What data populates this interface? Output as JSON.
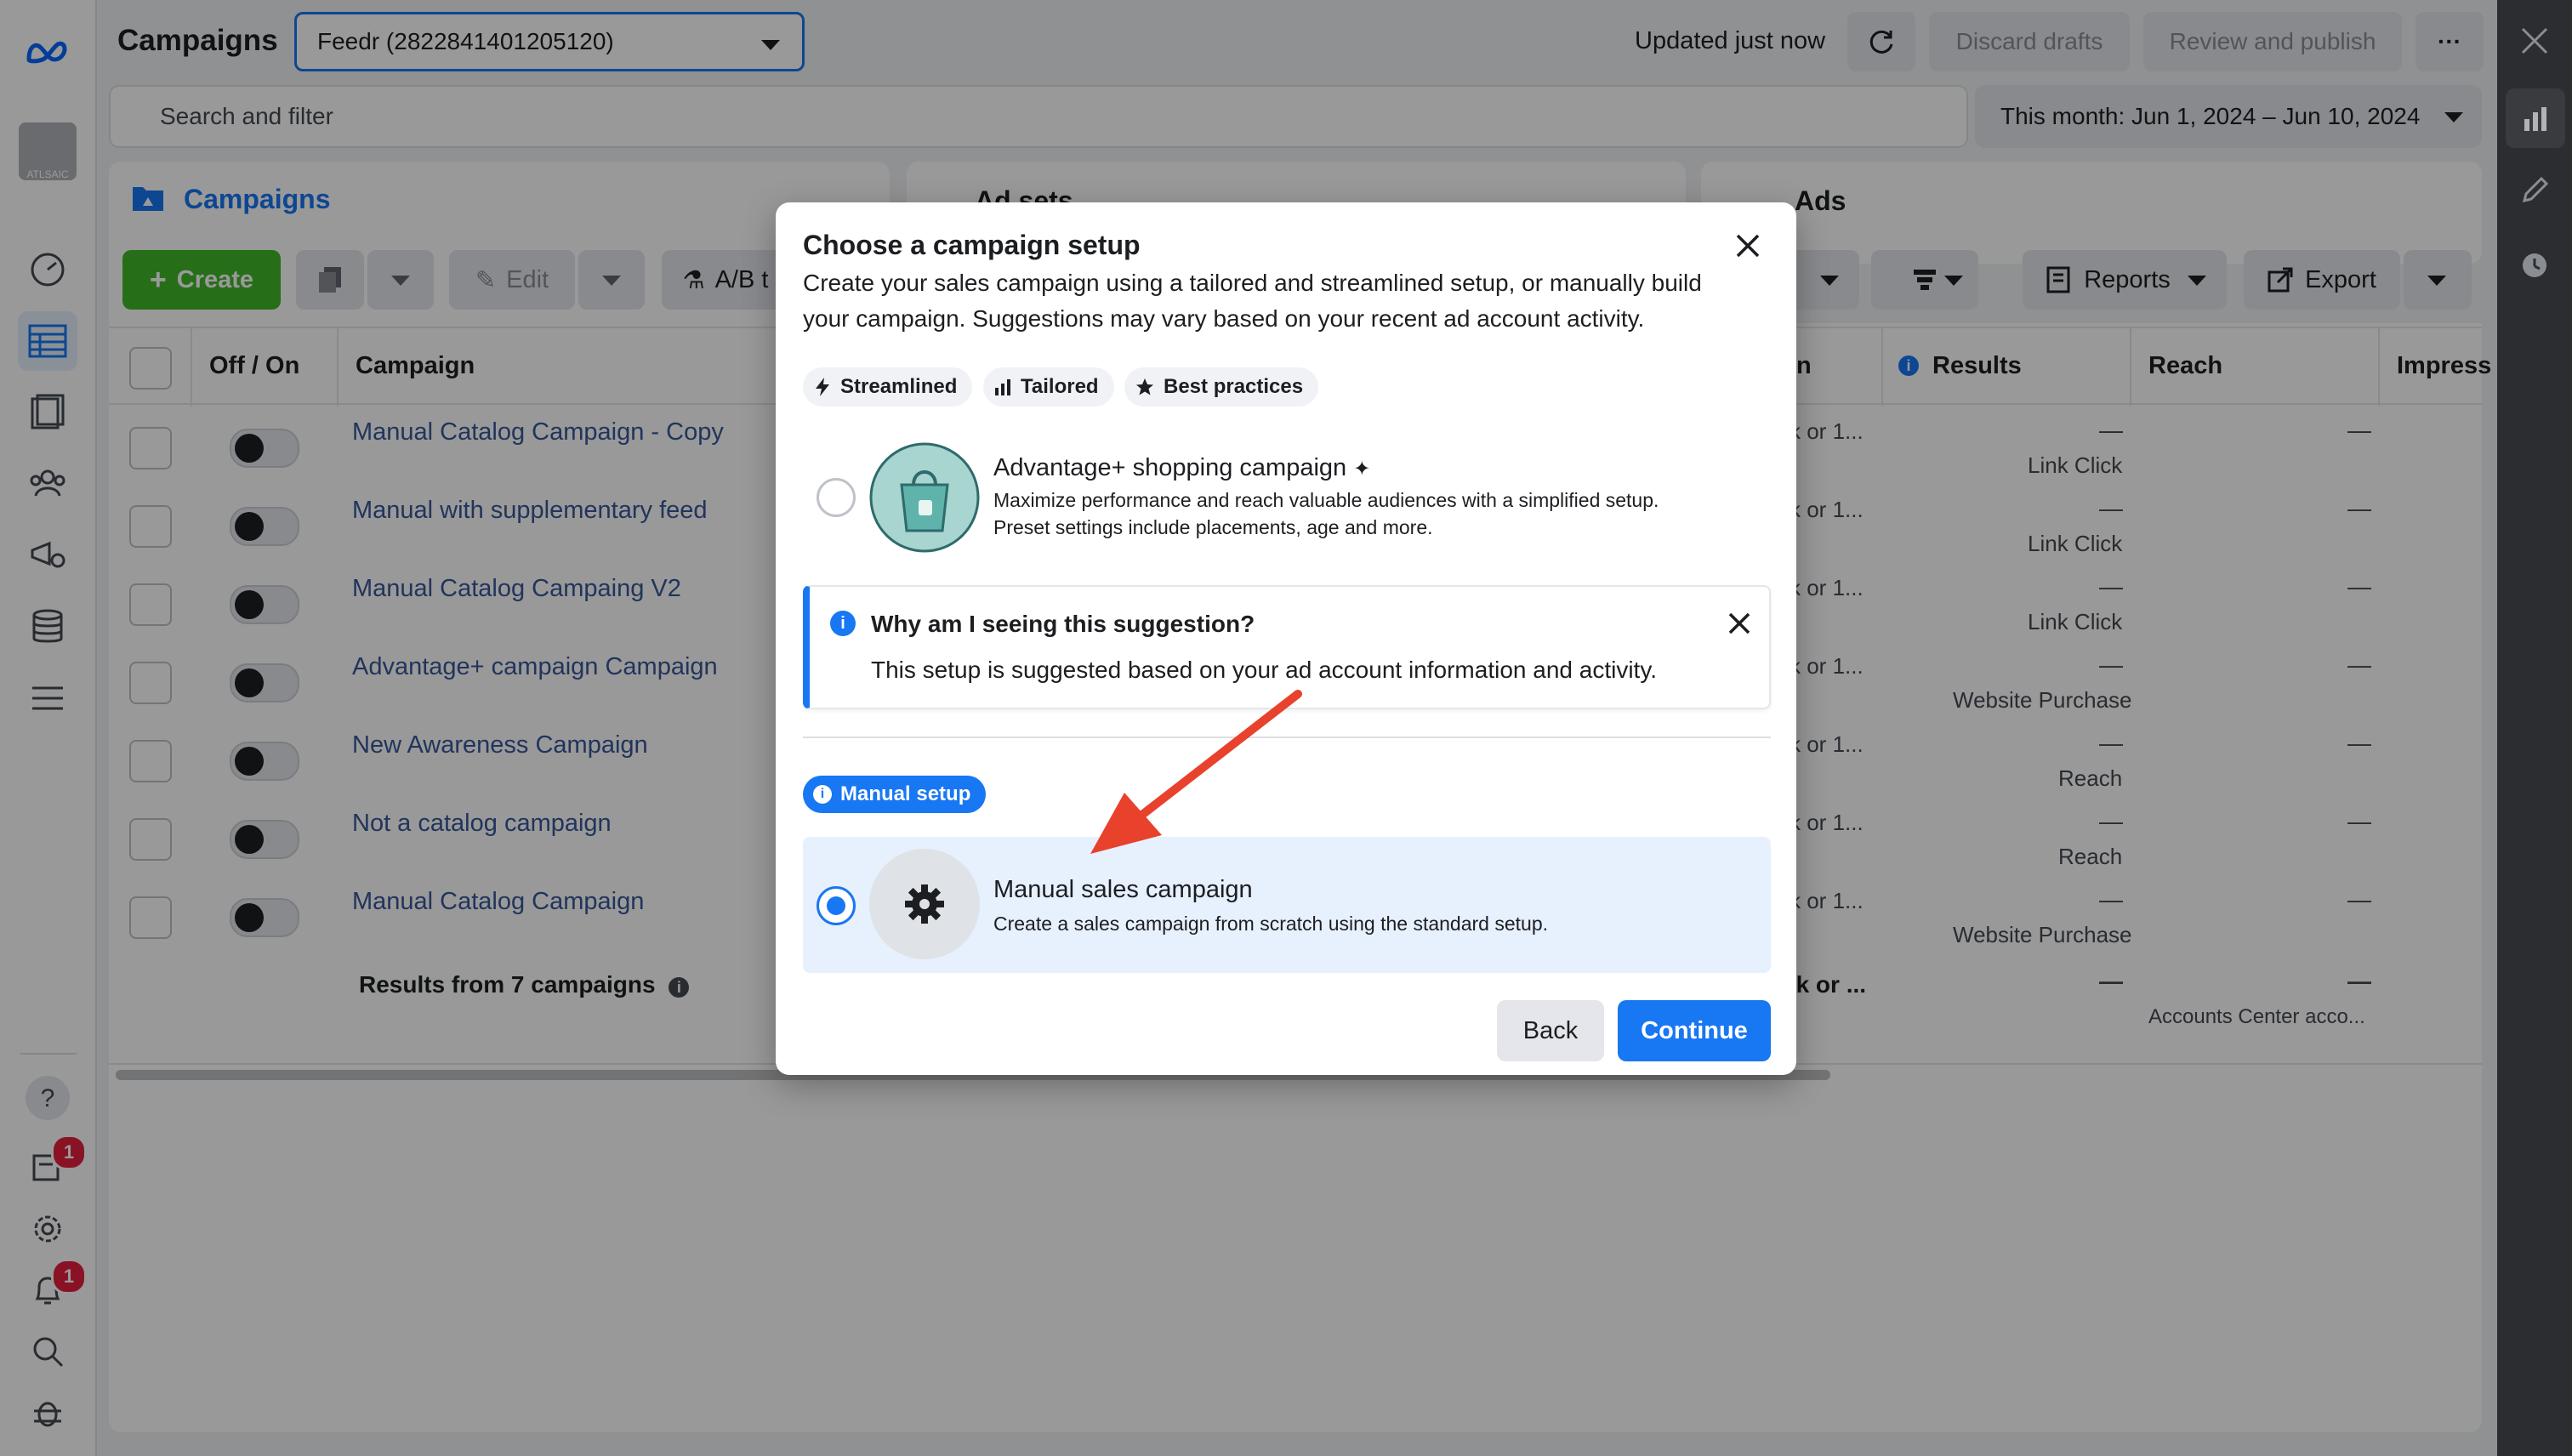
{
  "header": {
    "title": "Campaigns",
    "account_select": "Feedr (2822841401205120)",
    "updated_text": "Updated just now",
    "discard_drafts": "Discard drafts",
    "review_publish": "Review and publish",
    "more": "···"
  },
  "search": {
    "placeholder": "Search and filter"
  },
  "date_range": "This month: Jun 1, 2024 – Jun 10, 2024",
  "avatar_text": "ATLSAIC",
  "panels": {
    "campaigns": "Campaigns",
    "adsets": "Ad sets",
    "ads": "Ads"
  },
  "toolbar": {
    "create": "Create",
    "edit": "Edit",
    "ab_test": "A/B t",
    "reports": "Reports",
    "export": "Export"
  },
  "table": {
    "headers": {
      "off_on": "Off / On",
      "campaign": "Campaign",
      "attribution": "n",
      "results": "Results",
      "reach": "Reach",
      "impressions": "Impress"
    },
    "rows": [
      {
        "name": "Manual Catalog Campaign - Copy",
        "attribution": "k or 1...",
        "results": "—",
        "result_type": "Link Click",
        "reach": "—"
      },
      {
        "name": "Manual with supplementary feed",
        "attribution": "k or 1...",
        "results": "—",
        "result_type": "Link Click",
        "reach": "—"
      },
      {
        "name": "Manual Catalog Campaing V2",
        "attribution": "k or 1...",
        "results": "—",
        "result_type": "Link Click",
        "reach": "—"
      },
      {
        "name": "Advantage+ campaign Campaign",
        "attribution": "k or 1...",
        "results": "—",
        "result_type": "Website Purchase",
        "reach": "—"
      },
      {
        "name": "New Awareness Campaign",
        "attribution": "k or 1...",
        "results": "—",
        "result_type": "Reach",
        "reach": "—"
      },
      {
        "name": "Not a catalog campaign",
        "attribution": "k or 1...",
        "results": "—",
        "result_type": "Reach",
        "reach": "—"
      },
      {
        "name": "Manual Catalog Campaign",
        "attribution": "k or 1...",
        "results": "—",
        "result_type": "Website Purchase",
        "reach": "—"
      }
    ],
    "summary": {
      "label": "Results from 7 campaigns",
      "attribution": "ck or ...",
      "results": "—",
      "reach": "—",
      "reach_note": "Accounts Center acco..."
    }
  },
  "nav_badges": {
    "notifications": "1",
    "alerts": "1"
  },
  "modal": {
    "title": "Choose a campaign setup",
    "description": "Create your sales campaign using a tailored and streamlined setup, or manually build your campaign. Suggestions may vary based on your recent ad account activity.",
    "chips": [
      "Streamlined",
      "Tailored",
      "Best practices"
    ],
    "advantage": {
      "title": "Advantage+ shopping campaign",
      "desc_line1": "Maximize performance and reach valuable audiences with a simplified setup.",
      "desc_line2": "Preset settings include placements, age and more."
    },
    "info": {
      "title": "Why am I seeing this suggestion?",
      "body": "This setup is suggested based on your ad account information and activity."
    },
    "manual_pill": "Manual setup",
    "manual": {
      "title": "Manual sales campaign",
      "desc": "Create a sales campaign from scratch using the standard setup."
    },
    "back": "Back",
    "continue": "Continue"
  },
  "colors": {
    "primary": "#1877f2",
    "create_green": "#42b72a",
    "link": "#385898",
    "arrow": "#e8412c"
  }
}
